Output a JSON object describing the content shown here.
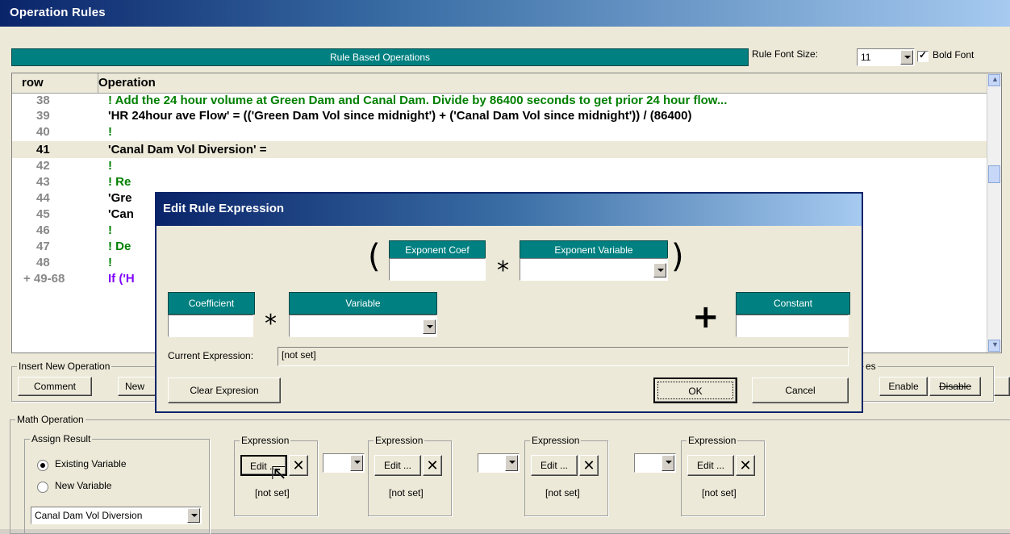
{
  "window": {
    "title": "Operation Rules"
  },
  "toolbar": {
    "header": "Rule Based Operations",
    "font_size_label": "Rule Font Size:",
    "font_size_value": "11",
    "bold_font_label": "Bold Font",
    "bold_font_checked": true
  },
  "grid": {
    "columns": [
      "row",
      "Operation"
    ],
    "rows": [
      {
        "row": "38",
        "text": "! Add the 24 hour volume at Green Dam and Canal Dam.  Divide by 86400 seconds to get prior 24 hour flow..."
      },
      {
        "row": "39",
        "text": "'HR 24hour ave Flow' = (('Green Dam Vol since midnight') + ('Canal Dam Vol since midnight')) / (86400)"
      },
      {
        "row": "40",
        "text": "!"
      },
      {
        "row": "41",
        "text": "'Canal Dam Vol Diversion' ="
      },
      {
        "row": "42",
        "text": "!"
      },
      {
        "row": "43",
        "text": "! Re"
      },
      {
        "row": "44",
        "text": "'Gre"
      },
      {
        "row": "45",
        "text": "'Can"
      },
      {
        "row": "46",
        "text": "!"
      },
      {
        "row": "47",
        "text": "! De"
      },
      {
        "row": "48",
        "text": "!"
      },
      {
        "row": "+ 49-68",
        "text": "If ('H"
      }
    ]
  },
  "insert_new_operation": {
    "legend": "Insert New Operation",
    "comment": "Comment",
    "new": "New"
  },
  "enable_group": {
    "legend_tail": "es",
    "enable": "Enable",
    "disable": "Disable"
  },
  "math_operation": {
    "legend": "Math Operation",
    "assign_result": {
      "legend": "Assign Result",
      "existing": "Existing Variable",
      "new": "New Variable",
      "selected": "Canal Dam Vol Diversion"
    },
    "expressions": [
      {
        "legend": "Expression",
        "edit": "Edit ...",
        "value": "[not set]"
      },
      {
        "legend": "Expression",
        "edit": "Edit ...",
        "value": "[not set]"
      },
      {
        "legend": "Expression",
        "edit": "Edit ...",
        "value": "[not set]"
      },
      {
        "legend": "Expression",
        "edit": "Edit ...",
        "value": "[not set]"
      }
    ]
  },
  "dialog": {
    "title": "Edit Rule Expression",
    "exponent_coef": "Exponent Coef",
    "exponent_variable": "Exponent Variable",
    "coefficient": "Coefficient",
    "variable": "Variable",
    "constant": "Constant",
    "open_paren": "(",
    "close_paren": ")",
    "times": "*",
    "plus": "+",
    "current_expression_label": "Current Expression:",
    "current_expression_value": "[not set]",
    "clear_button": "Clear Expresion",
    "ok_button": "OK",
    "cancel_button": "Cancel"
  }
}
